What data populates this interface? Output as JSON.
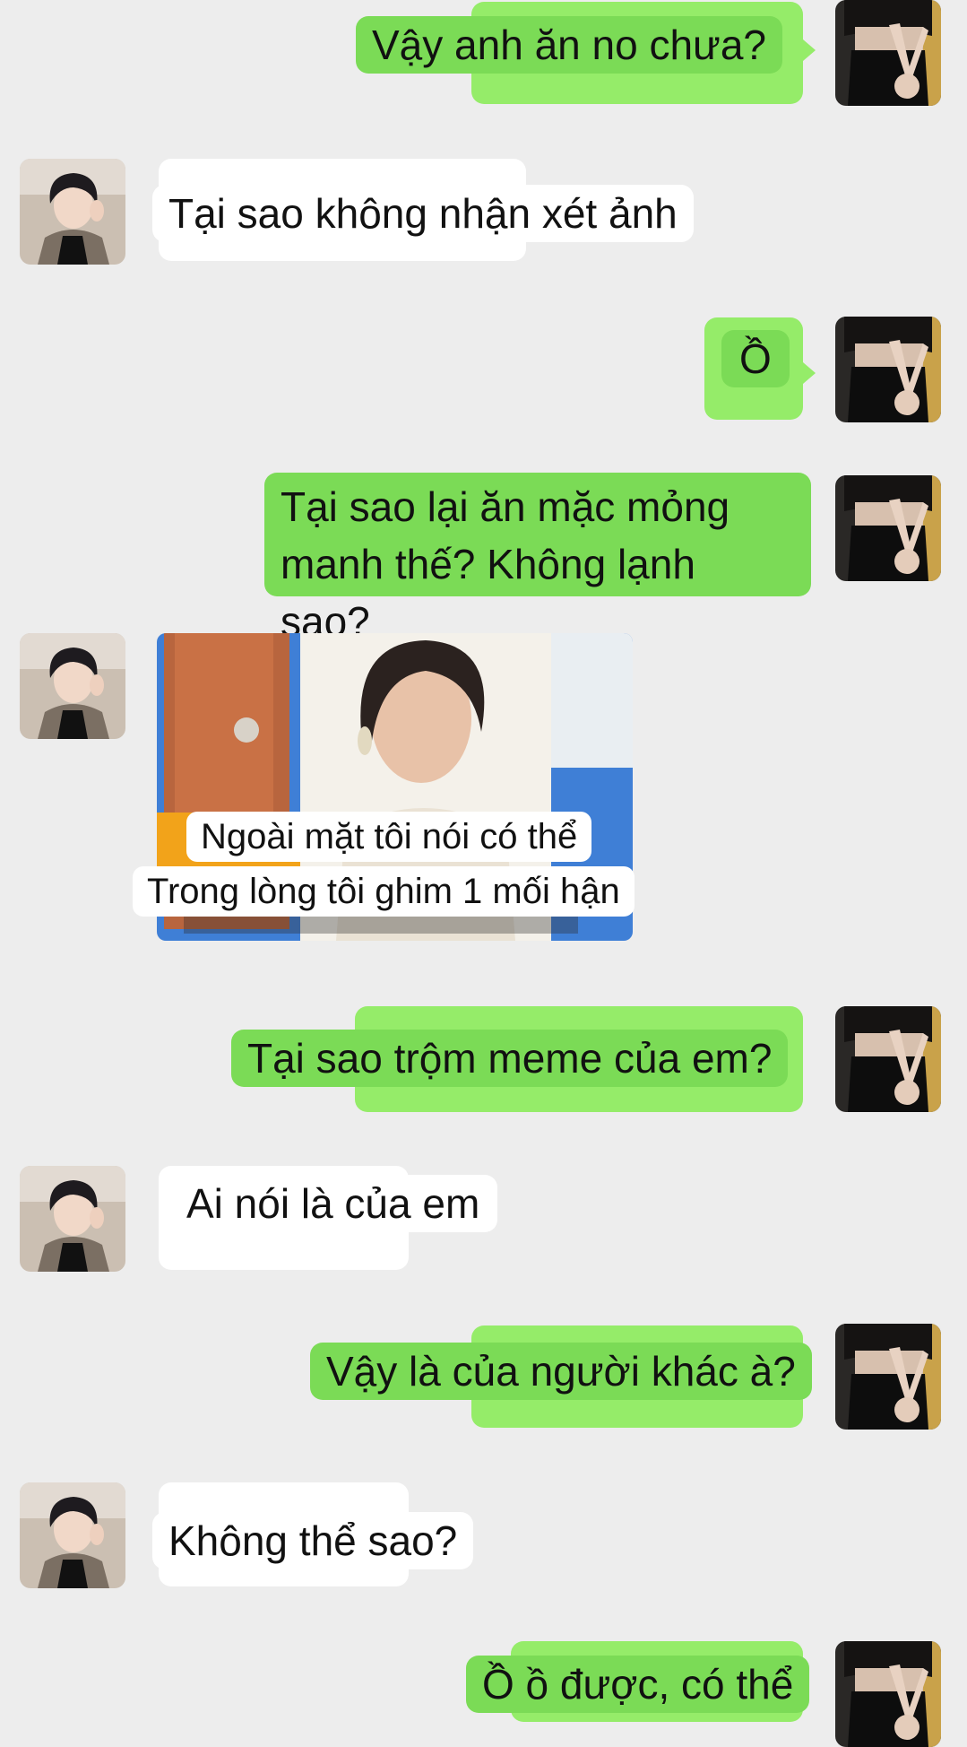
{
  "messages": [
    {
      "side": "right",
      "text": "Vậy anh ăn no chưa?"
    },
    {
      "side": "left",
      "text": "Tại sao không nhận xét ảnh"
    },
    {
      "side": "right",
      "text": "Ồ"
    },
    {
      "side": "right",
      "text": "Tại sao lại ăn mặc mỏng",
      "text2": "manh thế? Không lạnh sao?"
    },
    {
      "side": "left",
      "type": "image",
      "caption1": "Ngoài mặt tôi nói có thể",
      "caption2": "Trong lòng tôi ghim 1 mối hận"
    },
    {
      "side": "right",
      "text": "Tại sao trộm meme của em?"
    },
    {
      "side": "left",
      "text": "Ai nói là của em"
    },
    {
      "side": "right",
      "text": "Vậy là của người khác à?"
    },
    {
      "side": "left",
      "text": "Không thể sao?"
    },
    {
      "side": "right",
      "text": "Ồ ồ được, có thể"
    }
  ],
  "colors": {
    "background": "#ededed",
    "sent_bubble": "#95ec69",
    "received_bubble": "#ffffff"
  },
  "icons": {
    "left_avatar": "avatar-photo-young-man",
    "right_avatar": "avatar-photo-masked-man-peace-sign"
  }
}
